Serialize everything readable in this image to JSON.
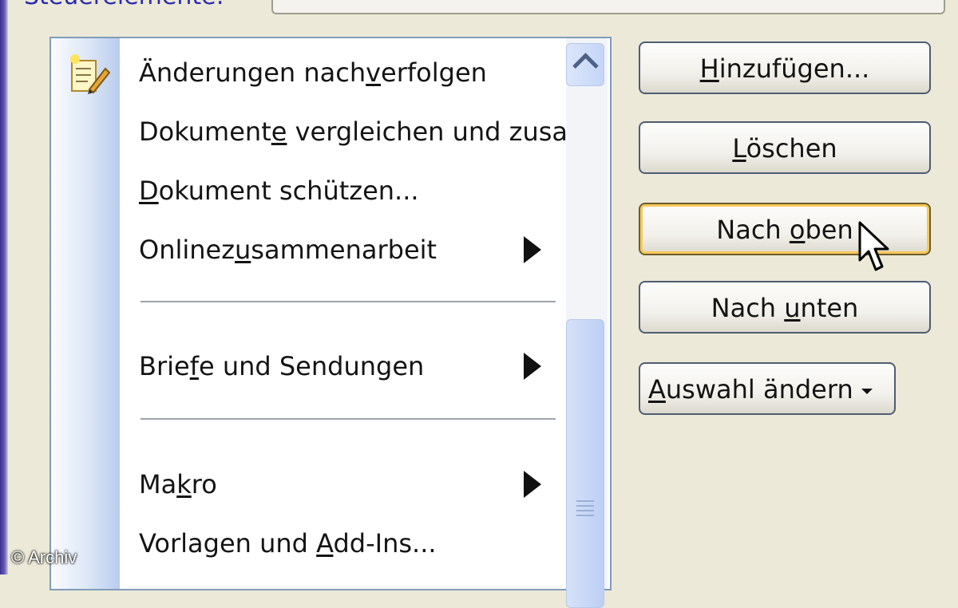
{
  "section": {
    "label": "Steuerelemente:"
  },
  "list": {
    "items": [
      {
        "pre": "Änderungen nach",
        "ul": "v",
        "post": "erfolgen",
        "submenu": false,
        "icon": "track-changes-icon"
      },
      {
        "pre": "Dokument",
        "ul": "e",
        "post": " vergleichen und zusa",
        "submenu": false
      },
      {
        "pre": "",
        "ul": "D",
        "post": "okument schützen...",
        "submenu": false
      },
      {
        "pre": "Onlinez",
        "ul": "u",
        "post": "sammenarbeit",
        "submenu": true
      },
      {
        "pre": "Brie",
        "ul": "f",
        "post": "e und Sendungen",
        "submenu": true
      },
      {
        "pre": "Ma",
        "ul": "k",
        "post": "ro",
        "submenu": true
      },
      {
        "pre": "Vorlagen und ",
        "ul": "A",
        "post": "dd-Ins...",
        "submenu": false
      }
    ]
  },
  "buttons": {
    "add": {
      "ul": "H",
      "post": "inzufügen..."
    },
    "delete": {
      "ul": "L",
      "post": "öschen"
    },
    "up": {
      "pre": "Nach ",
      "ul": "o",
      "post": "ben"
    },
    "down": {
      "pre": "Nach ",
      "ul": "u",
      "post": "nten"
    },
    "modify": {
      "ul": "A",
      "post": "uswahl ändern"
    }
  },
  "watermark": "© Archiv",
  "colors": {
    "dialog_bg": "#ece9d8",
    "label_blue": "#2b2bb0",
    "hot_border": "#f7c85a",
    "menu_strip": "#b9cdec"
  }
}
